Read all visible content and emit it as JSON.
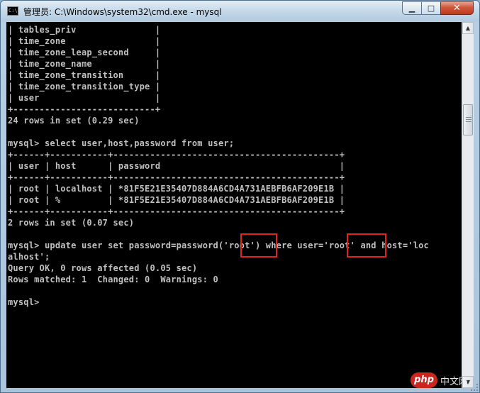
{
  "window": {
    "title": "管理员: C:\\Windows\\system32\\cmd.exe - mysql",
    "icon": "cmd-icon",
    "controls": {
      "minimize": "▁",
      "maximize": "□",
      "close": "✕"
    }
  },
  "console": {
    "lines": [
      "| tables_priv               |",
      "| time_zone                 |",
      "| time_zone_leap_second     |",
      "| time_zone_name            |",
      "| time_zone_transition      |",
      "| time_zone_transition_type |",
      "| user                      |",
      "+---------------------------+",
      "24 rows in set (0.29 sec)",
      "",
      "mysql> select user,host,password from user;",
      "+------+-----------+-------------------------------------------+",
      "| user | host      | password                                  |",
      "+------+-----------+-------------------------------------------+",
      "| root | localhost | *81F5E21E35407D884A6CD4A731AEBFB6AF209E1B |",
      "| root | %         | *81F5E21E35407D884A6CD4A731AEBFB6AF209E1B |",
      "+------+-----------+-------------------------------------------+",
      "2 rows in set (0.07 sec)",
      "",
      "mysql> update user set password=password('root') where user='root' and host='loc",
      "alhost';",
      "Query OK, 0 rows affected (0.05 sec)",
      "Rows matched: 1  Changed: 0  Warnings: 0",
      "",
      "mysql>"
    ]
  },
  "watermark": {
    "badge": "php",
    "text": "中文网"
  }
}
